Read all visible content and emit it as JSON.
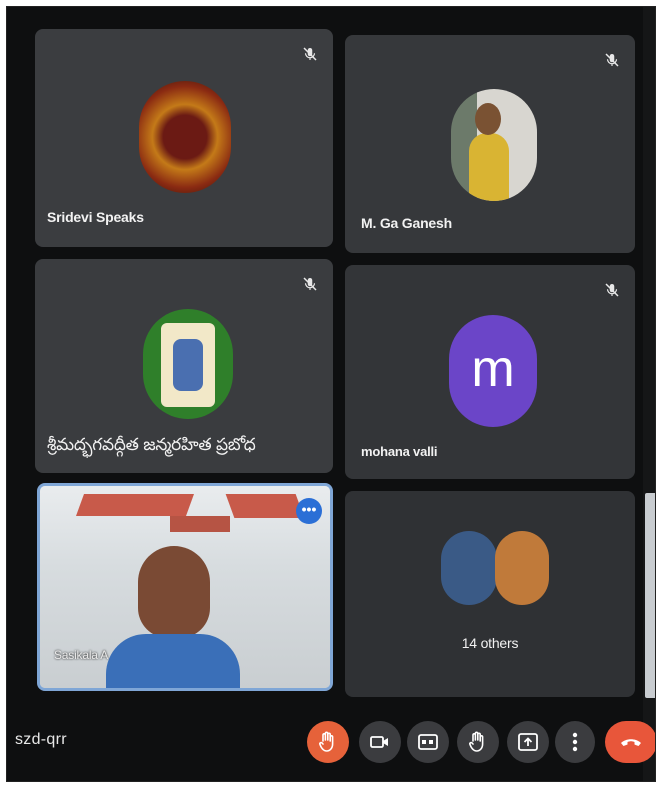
{
  "meeting": {
    "code": "szd-qrr"
  },
  "participants": [
    {
      "name": "Sridevi Speaks",
      "muted": true
    },
    {
      "name": "M. Ga Ganesh",
      "muted": true
    },
    {
      "name": "శ్రీమద్భగవద్గీత జన్మరహిత ప్రబోధ",
      "muted": true
    },
    {
      "name": "mohana valli",
      "muted": true,
      "initial": "m",
      "avatar_color": "#6b45c8"
    },
    {
      "name": "Sasikala A",
      "active_speaker": true
    },
    {
      "name": "14 others"
    }
  ],
  "controls": [
    {
      "id": "raise-hand",
      "icon": "hand-icon",
      "active": true
    },
    {
      "id": "camera",
      "icon": "camera-icon"
    },
    {
      "id": "captions",
      "icon": "cc-icon"
    },
    {
      "id": "hand",
      "icon": "hand-icon"
    },
    {
      "id": "present",
      "icon": "present-icon"
    },
    {
      "id": "more",
      "icon": "more-vert-icon"
    },
    {
      "id": "leave",
      "icon": "phone-hangup-icon"
    }
  ],
  "colors": {
    "background": "#0e0f10",
    "tile": "#3a3b3e",
    "accent_orange": "#e6623a",
    "leave_red": "#e8563a",
    "active_border": "#7fa6d6",
    "more_blue": "#2b6fd6"
  },
  "more_options_label": "•••"
}
